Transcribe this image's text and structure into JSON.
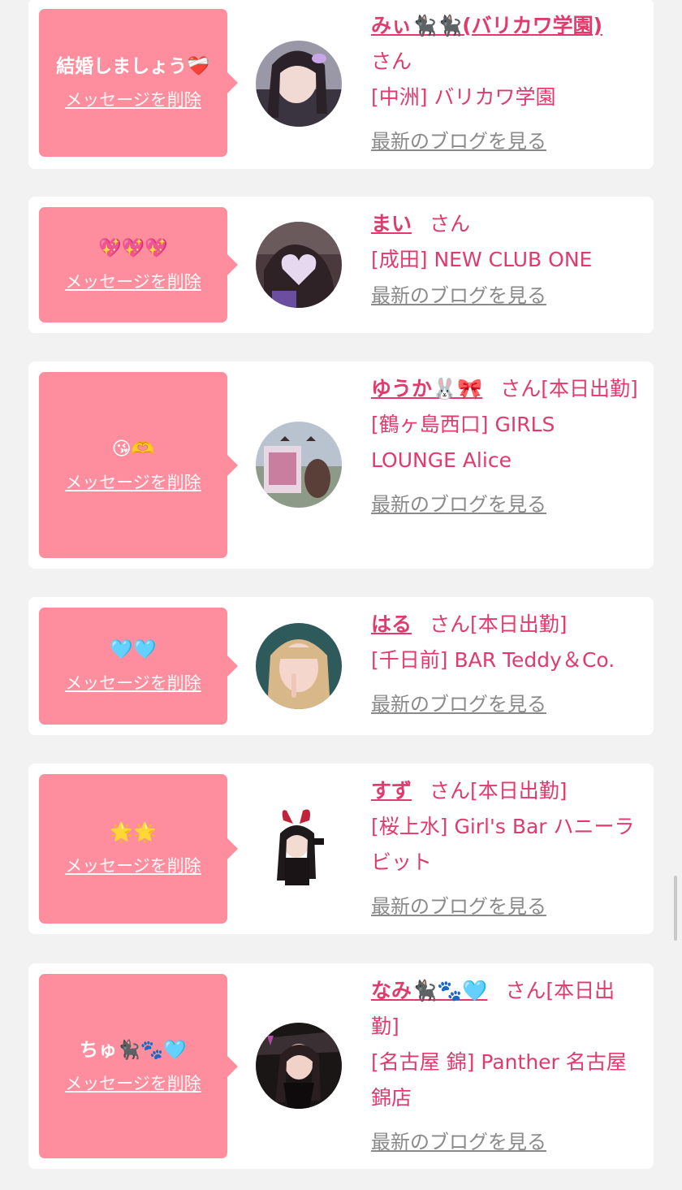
{
  "colors": {
    "page_bg": "#f2f2f2",
    "card_bg": "#ffffff",
    "bubble_bg": "#fe8e9d",
    "accent_text": "#e13a6c",
    "link_gray": "#8a8a8a"
  },
  "delete_label": "メッセージを削除",
  "san_label": "さん",
  "blog_label": "最新のブログを見る",
  "cards": [
    {
      "message": "結婚しましょう❤️‍🩹",
      "name": "みぃ🐈‍⬛🐈‍⬛(バリカワ学園)",
      "suffix": "",
      "shop": "[中洲] バリカワ学園",
      "avatar_icon": "photo-avatar-woman-dark-hair"
    },
    {
      "message": "💖💖💖",
      "name": "まい",
      "suffix": "",
      "shop": "[成田] NEW CLUB ONE",
      "avatar_icon": "photo-avatar-secret-heart"
    },
    {
      "message": "😘🫶",
      "name": "ゆうか🐰🎀",
      "suffix": "[本日出勤]",
      "shop": "[鶴ヶ島西口] GIRLS LOUNGE Alice",
      "avatar_icon": "photo-avatar-outdoor"
    },
    {
      "message": "🩵🩵",
      "name": "はる",
      "suffix": "[本日出勤]",
      "shop": "[千日前] BAR Teddy＆Co.",
      "avatar_icon": "photo-avatar-blonde"
    },
    {
      "message": "🌟🌟",
      "name": "すず",
      "suffix": "[本日出勤]",
      "shop": "[桜上水] Girl's Bar ハニーラビット",
      "avatar_icon": "photo-avatar-bunny-ears"
    },
    {
      "message": "ちゅ🐈‍⬛🐾🩵",
      "name": "なみ🐈‍⬛🐾🩵",
      "suffix": "[本日出勤]",
      "shop": "[名古屋 錦] Panther 名古屋錦店",
      "avatar_icon": "photo-avatar-panther"
    }
  ]
}
